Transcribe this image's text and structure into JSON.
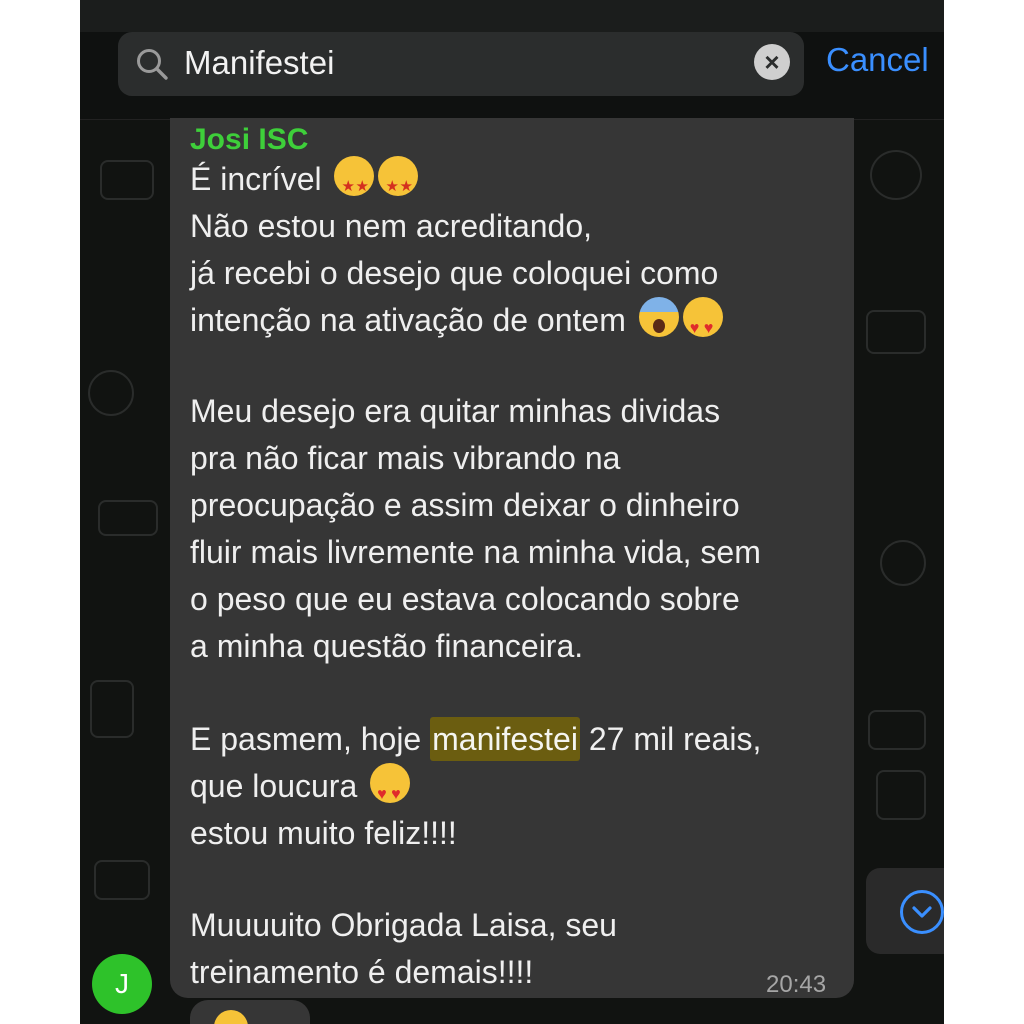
{
  "search": {
    "query": "Manifestei",
    "cancel_label": "Cancel"
  },
  "message": {
    "sender": "Josi ISC",
    "lines": [
      "É incrível",
      "Não estou nem acreditando,",
      "já recebi o desejo que coloquei como",
      "intenção na ativação de ontem",
      "",
      "Meu desejo era quitar minhas dividas",
      "pra não ficar mais vibrando na",
      "preocupação e assim deixar o dinheiro",
      "fluir mais livremente na minha vida, sem",
      "o peso que eu estava colocando sobre",
      "a minha questão financeira.",
      "",
      "E pasmem, hoje",
      "que loucura",
      "estou muito feliz!!!!",
      "",
      "Muuuuito Obrigada Laisa, seu",
      "treinamento é demais!!!!"
    ],
    "highlight_word": "manifestei",
    "after_highlight": "27 mil reais,",
    "time": "20:43"
  },
  "avatar": {
    "initial": "J"
  },
  "colors": {
    "sender_name": "#3ecf3a",
    "accent": "#3a8fff",
    "bubble": "#363636",
    "highlight": "#6b5d10",
    "avatar": "#2ec22a"
  },
  "icons": [
    "search-icon",
    "clear-icon",
    "chevron-down-icon",
    "star-struck-emoji",
    "heart-eyes-emoji",
    "screaming-emoji"
  ]
}
